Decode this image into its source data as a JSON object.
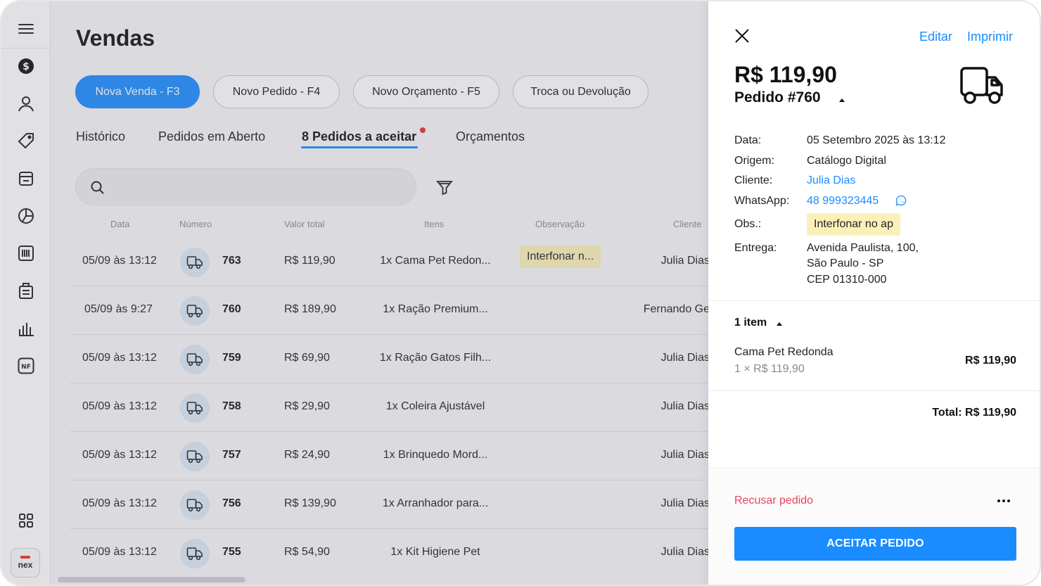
{
  "page": {
    "title": "Vendas"
  },
  "actions": [
    {
      "label": "Nova Venda - F3"
    },
    {
      "label": "Novo Pedido - F4"
    },
    {
      "label": "Novo Orçamento - F5"
    },
    {
      "label": "Troca ou Devolução"
    }
  ],
  "tabs": [
    {
      "label": "Histórico"
    },
    {
      "label": "Pedidos em Aberto"
    },
    {
      "label": "8 Pedidos a aceitar"
    },
    {
      "label": "Orçamentos"
    }
  ],
  "search": {
    "placeholder": "",
    "value": ""
  },
  "table": {
    "headers": [
      "Data",
      "Número",
      "Valor total",
      "Itens",
      "Observação",
      "Cliente"
    ],
    "rows": [
      {
        "date": "05/09 às 13:12",
        "number": "763",
        "value": "R$ 119,90",
        "items": "1x Cama Pet Redon...",
        "obs": "Interfonar n...",
        "client": "Julia Dias"
      },
      {
        "date": "05/09 às 9:27",
        "number": "760",
        "value": "R$ 189,90",
        "items": "1x Ração Premium...",
        "obs": "",
        "client": "Fernando Ge"
      },
      {
        "date": "05/09 às 13:12",
        "number": "759",
        "value": "R$ 69,90",
        "items": "1x Ração Gatos Filh...",
        "obs": "",
        "client": "Julia Dias"
      },
      {
        "date": "05/09 às 13:12",
        "number": "758",
        "value": "R$ 29,90",
        "items": "1x Coleira Ajustável",
        "obs": "",
        "client": "Julia Dias"
      },
      {
        "date": "05/09 às 13:12",
        "number": "757",
        "value": "R$ 24,90",
        "items": "1x Brinquedo Mord...",
        "obs": "",
        "client": "Julia Dias"
      },
      {
        "date": "05/09 às 13:12",
        "number": "756",
        "value": "R$ 139,90",
        "items": "1x Arranhador para...",
        "obs": "",
        "client": "Julia Dias"
      },
      {
        "date": "05/09 às 13:12",
        "number": "755",
        "value": "R$ 54,90",
        "items": "1x Kit Higiene Pet",
        "obs": "",
        "client": "Julia Dias"
      }
    ]
  },
  "drawer": {
    "edit_label": "Editar",
    "print_label": "Imprimir",
    "amount": "R$ 119,90",
    "order_title": "Pedido #760",
    "fields": {
      "date_label": "Data:",
      "date_value": "05 Setembro 2025 às 13:12",
      "origin_label": "Origem:",
      "origin_value": "Catálogo Digital",
      "client_label": "Cliente:",
      "client_value": "Julia Dias",
      "whatsapp_label": "WhatsApp:",
      "whatsapp_value": "48 999323445",
      "obs_label": "Obs.:",
      "obs_value": "Interfonar no ap",
      "delivery_label": "Entrega:",
      "delivery_line1": "Avenida Paulista, 100,",
      "delivery_line2": "São Paulo - SP",
      "delivery_line3": "CEP 01310-000"
    },
    "items_count": "1 item",
    "item": {
      "name": "Cama Pet Redonda",
      "qty_price": "1 × R$ 119,90",
      "price": "R$ 119,90"
    },
    "total": "Total: R$ 119,90",
    "refuse_label": "Recusar pedido",
    "accept_label": "ACEITAR PEDIDO"
  },
  "colors": {
    "accent": "#1a8cff",
    "danger": "#e8445a",
    "obs_highlight": "#fbf1b8",
    "badge_dot": "#e8312f"
  },
  "brand": {
    "logo_text": "nex"
  }
}
